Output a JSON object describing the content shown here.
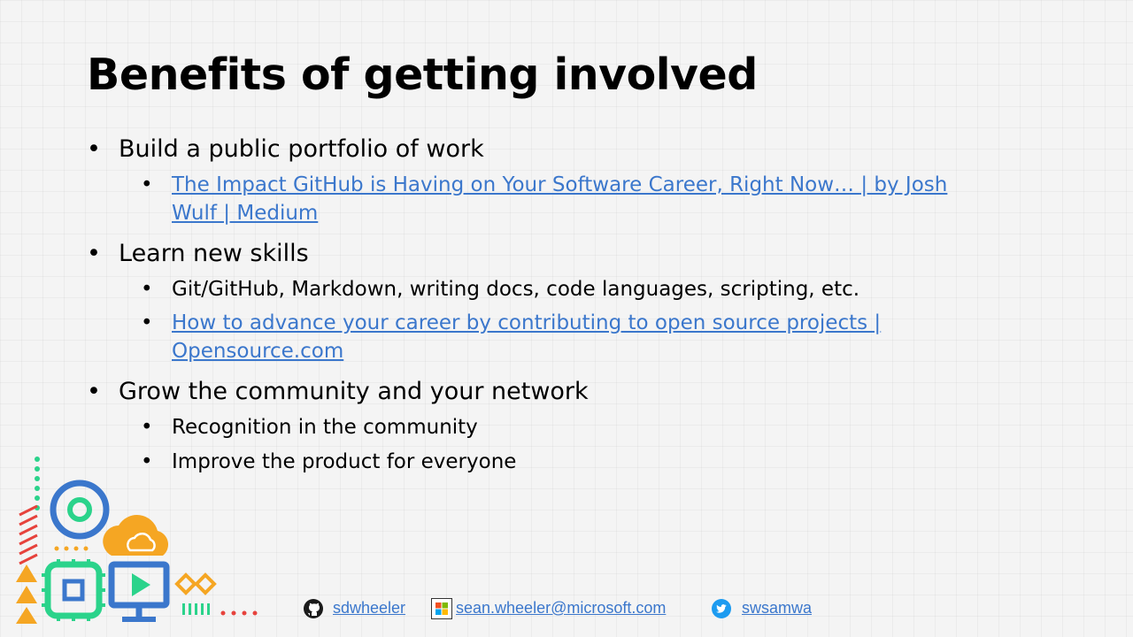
{
  "slide": {
    "title": "Benefits of getting involved",
    "bullets": {
      "b1": "Build a public portfolio of work",
      "b1_sub1_line1": "The Impact GitHub is Having on Your Software Career, Right Now… | by Josh",
      "b1_sub1_line2": "Wulf | Medium",
      "b2": "Learn new skills",
      "b2_sub1": "Git/GitHub, Markdown, writing docs, code languages, scripting, etc.",
      "b2_sub2_line1": "How to advance your career by contributing to open source projects  |",
      "b2_sub2_line2": "Opensource.com",
      "b3": "Grow the community and your network",
      "b3_sub1": "Recognition in the community",
      "b3_sub2": "Improve the product for everyone"
    },
    "bullet_glyph": "•"
  },
  "footer": {
    "github": "sdwheeler",
    "email": "sean.wheeler@microsoft.com",
    "twitter": "swsamwa"
  },
  "icons": {
    "github": "github-icon",
    "microsoft": "microsoft-logo-icon",
    "twitter": "twitter-icon"
  },
  "colors": {
    "link": "#3b77cc",
    "blue": "#3b77cc",
    "green": "#2bd38b",
    "orange": "#f5a623",
    "red": "#e6423c"
  }
}
